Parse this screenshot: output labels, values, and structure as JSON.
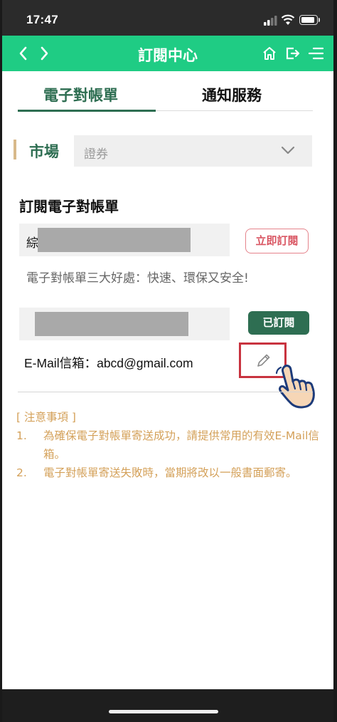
{
  "status_bar": {
    "time": "17:47"
  },
  "header": {
    "title": "訂閱中心",
    "back_icon": "chevron-left-icon",
    "forward_icon": "chevron-right-icon",
    "home_icon": "home-icon",
    "logout_icon": "logout-icon",
    "menu_icon": "menu-icon",
    "color": "#1fcc84"
  },
  "tabs": [
    {
      "label": "電子對帳單",
      "active": true
    },
    {
      "label": "通知服務",
      "active": false
    }
  ],
  "market": {
    "label": "市場",
    "selected": "證券"
  },
  "section_title": "訂閱電子對帳單",
  "accounts": [
    {
      "prefix": "綜",
      "button_label": "立即訂閱"
    },
    {
      "prefix": "",
      "button_label": "已訂閱"
    }
  ],
  "benefit_text": "電子對帳單三大好處：快速、環保又安全!",
  "email_line": "E-Mail信箱：abcd@gmail.com",
  "notes": {
    "heading": "[ 注意事項 ]",
    "items": [
      {
        "num": "1.",
        "text": "為確保電子對帳單寄送成功，請提供常用的有效E-Mail信箱。"
      },
      {
        "num": "2.",
        "text": "電子對帳單寄送失敗時，當期將改以一般書面郵寄。"
      }
    ]
  },
  "colors": {
    "accent": "#2e6e52",
    "note": "#d4a15a",
    "danger": "#d95562"
  }
}
